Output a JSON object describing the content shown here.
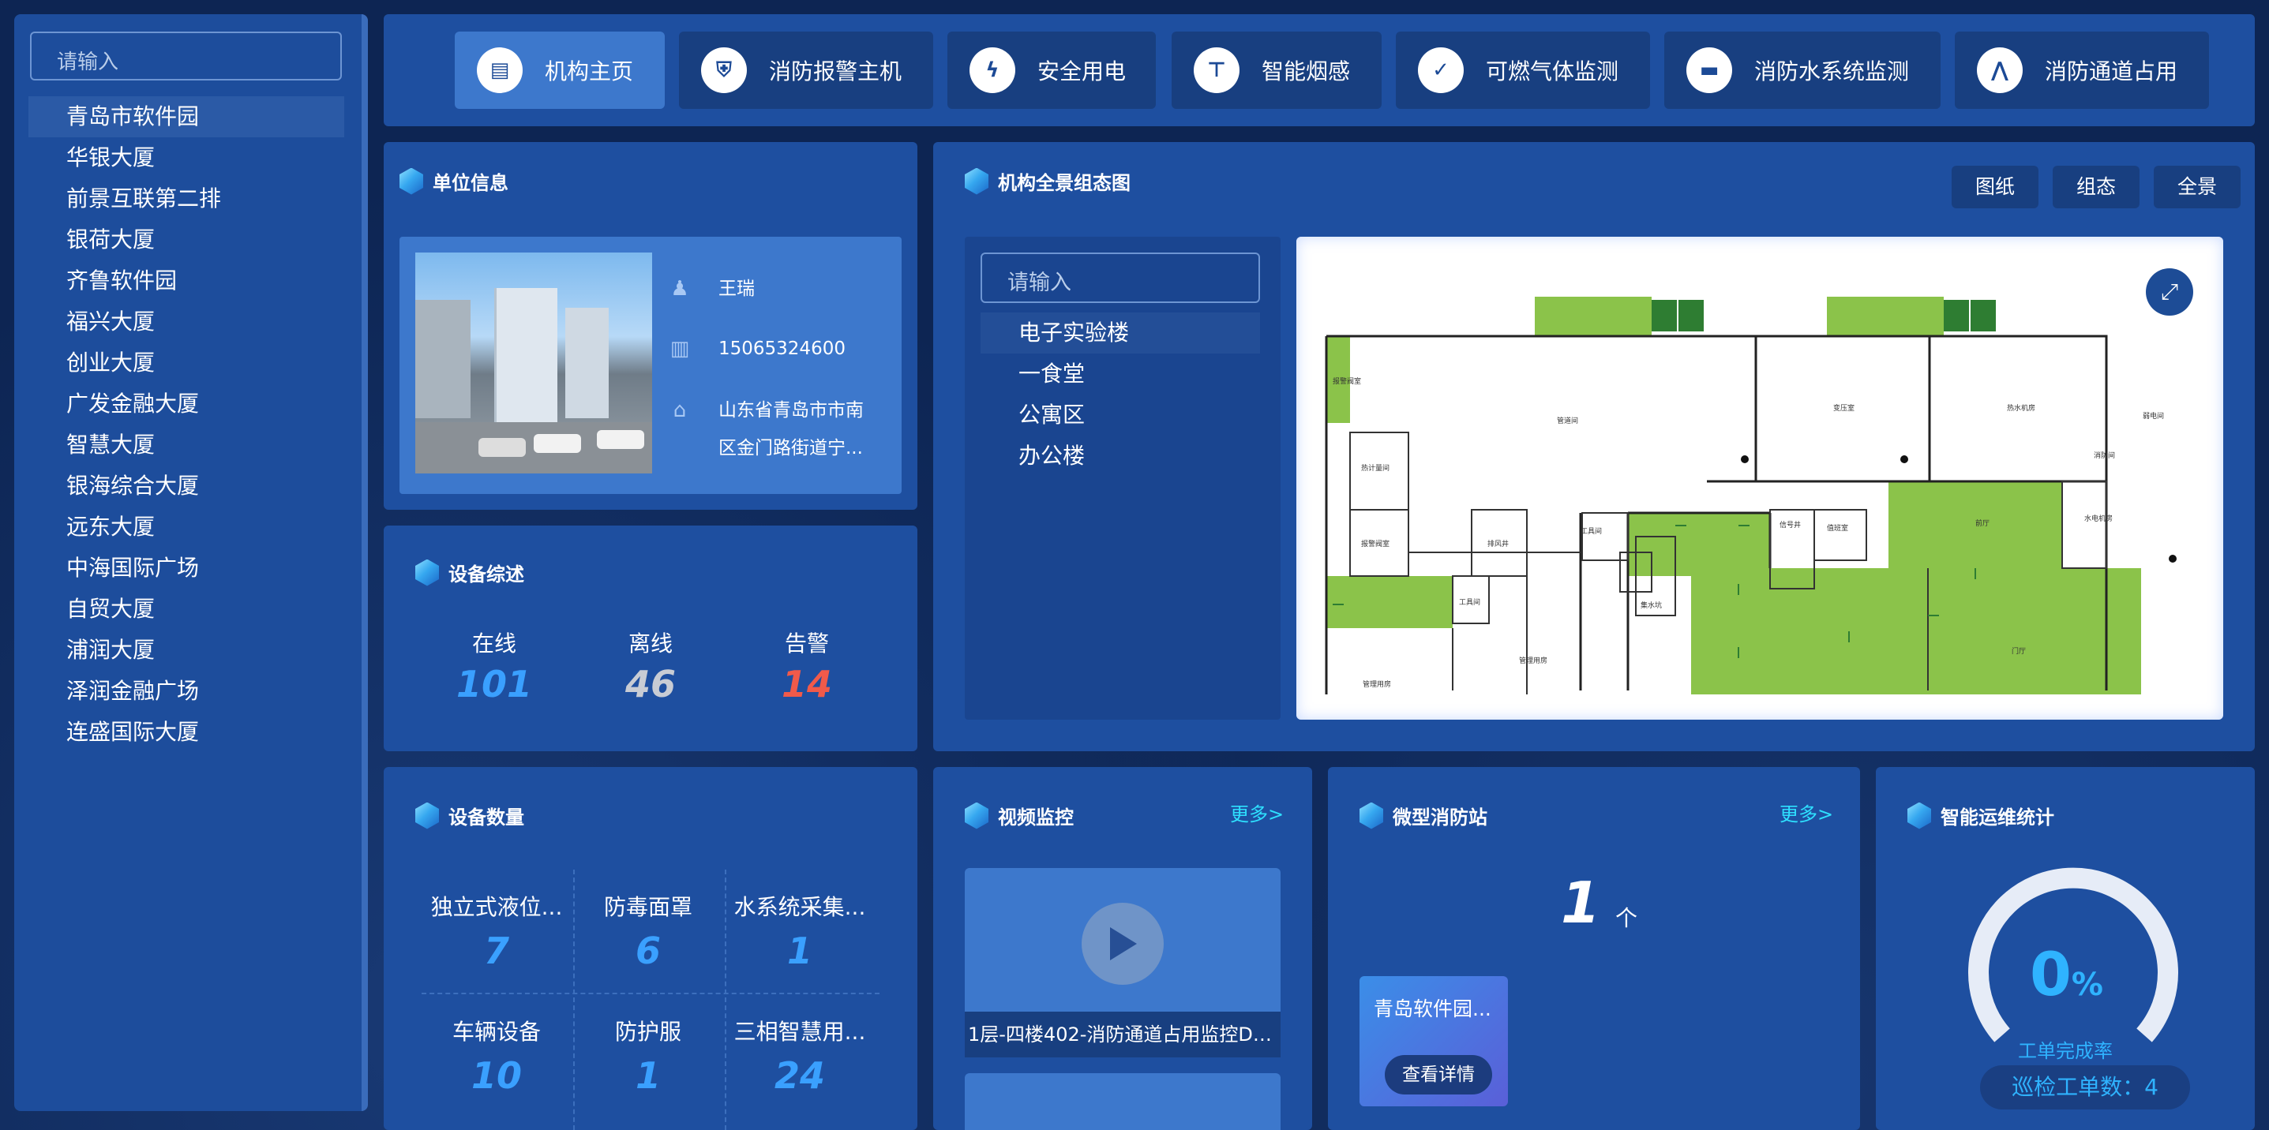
{
  "sidebar": {
    "search_placeholder": "请输入",
    "items": [
      "青岛市软件园",
      "华银大厦",
      "前景互联第二排",
      "银荷大厦",
      "齐鲁软件园",
      "福兴大厦",
      "创业大厦",
      "广发金融大厦",
      "智慧大厦",
      "银海综合大厦",
      "远东大厦",
      "中海国际广场",
      "自贸大厦",
      "浦润大厦",
      "泽润金融广场",
      "连盛国际大厦"
    ],
    "active_index": 0
  },
  "nav": {
    "items": [
      {
        "label": "机构主页",
        "icon": "building-icon",
        "active": true
      },
      {
        "label": "消防报警主机",
        "icon": "shield-icon"
      },
      {
        "label": "安全用电",
        "icon": "lightning-icon"
      },
      {
        "label": "智能烟感",
        "icon": "smoke-detector-icon"
      },
      {
        "label": "可燃气体监测",
        "icon": "check-icon"
      },
      {
        "label": "消防水系统监测",
        "icon": "water-icon"
      },
      {
        "label": "消防通道占用",
        "icon": "road-icon"
      }
    ]
  },
  "unit": {
    "title": "单位信息",
    "contact": "王瑞",
    "phone": "15065324600",
    "address_line1": "山东省青岛市市南",
    "address_line2": "区金门路街道宁..."
  },
  "overview": {
    "title": "设备综述",
    "online_label": "在线",
    "online": "101",
    "offline_label": "离线",
    "offline": "46",
    "alarm_label": "告警",
    "alarm": "14",
    "colors": {
      "online": "#3aa0ff",
      "offline": "#c8ccd4",
      "alarm": "#f05a4a"
    }
  },
  "pano": {
    "title": "机构全景组态图",
    "buttons": [
      "图纸",
      "组态",
      "全景"
    ],
    "search_placeholder": "请输入",
    "buildings": [
      "电子实验楼",
      "一食堂",
      "公寓区",
      "办公楼"
    ],
    "active_index": 0,
    "floor_labels": {
      "r1": "报警阀室",
      "r2": "弱电间",
      "r3": "热计量间",
      "r4": "报警阀室",
      "r5": "排风井",
      "r6": "工具间",
      "r7": "管理用房",
      "r8": "工具间",
      "r9": "管道间",
      "r10": "集水坑",
      "r11": "消防间",
      "r12": "变压室",
      "r13": "热水机房",
      "r14": "信号井",
      "r15": "值班室",
      "r16": "前厅",
      "r17": "门厅",
      "r18": "水电机房",
      "r19": "管理用房"
    }
  },
  "counts": {
    "title": "设备数量",
    "items": [
      {
        "label": "独立式液位...",
        "value": "7"
      },
      {
        "label": "防毒面罩",
        "value": "6"
      },
      {
        "label": "水系统采集...",
        "value": "1"
      },
      {
        "label": "车辆设备",
        "value": "10"
      },
      {
        "label": "防护服",
        "value": "1"
      },
      {
        "label": "三相智慧用...",
        "value": "24"
      }
    ]
  },
  "video": {
    "title": "视频监控",
    "more": "更多>",
    "caption": "1层-四楼402-消防通道占用监控DH..."
  },
  "station": {
    "title": "微型消防站",
    "more": "更多>",
    "count": "1",
    "unit": "个",
    "card_name": "青岛软件园...",
    "detail_button": "查看详情"
  },
  "ops": {
    "title": "智能运维统计",
    "percent": "0",
    "percent_sign": "%",
    "label": "工单完成率",
    "patrol": "巡检工单数：4",
    "completion_fraction": 0
  }
}
